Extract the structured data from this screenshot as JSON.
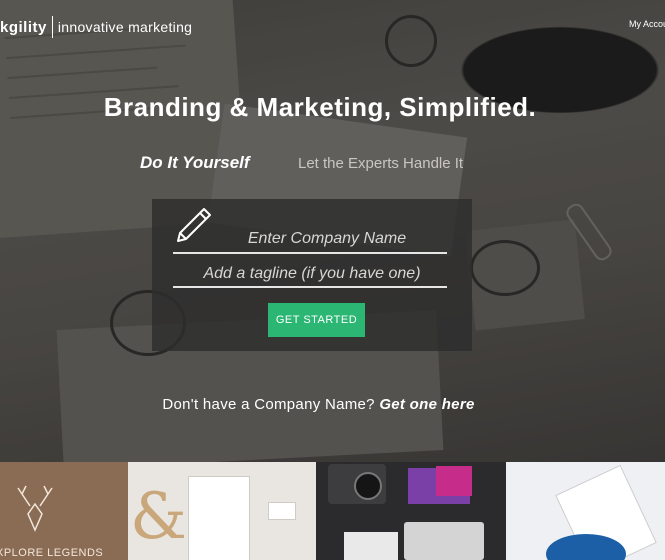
{
  "header": {
    "logo_brand": "kgility",
    "logo_tagline": "innovative marketing",
    "account_link": "My Account"
  },
  "hero": {
    "headline": "Branding & Marketing, Simplified.",
    "tabs": [
      {
        "label": "Do It Yourself",
        "active": true
      },
      {
        "label": "Let the Experts Handle It",
        "active": false
      }
    ]
  },
  "form": {
    "company_placeholder": "Enter Company Name",
    "tagline_placeholder": "Add a tagline (if you have one)",
    "company_value": "",
    "tagline_value": "",
    "submit_label": "GET STARTED",
    "icon": "pencil-icon"
  },
  "prompt": {
    "text": "Don't have a Company Name?",
    "link": "Get one here"
  },
  "gallery": {
    "tile1_label": "XPLORE LEGENDS"
  },
  "colors": {
    "accent": "#2bb673",
    "form_bg": "#2d2d2d",
    "text": "#ffffff"
  }
}
